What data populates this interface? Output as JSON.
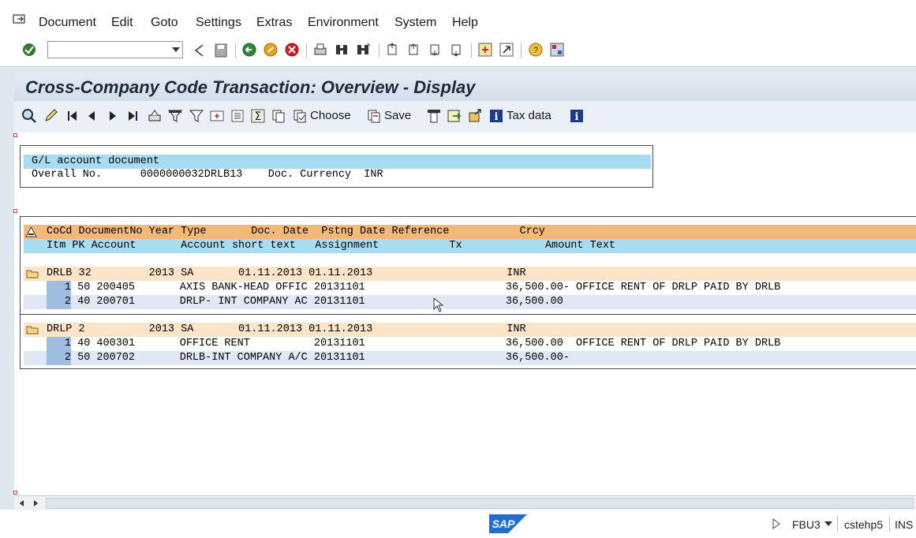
{
  "menu": {
    "items": [
      "Document",
      "Edit",
      "Goto",
      "Settings",
      "Extras",
      "Environment",
      "System",
      "Help"
    ]
  },
  "command_field": {
    "value": ""
  },
  "title": "Cross-Company Code Transaction: Overview - Display",
  "app_toolbar": {
    "choose_label": "Choose",
    "save_label": "Save",
    "tax_label": "Tax data"
  },
  "header": {
    "title": "G/L account document",
    "line": "Overall No.      0000000032DRLB13    Doc. Currency  INR"
  },
  "list": {
    "header1": "CoCd DocumentNo Year Type       Doc. Date  Pstng Date Reference           Crcy",
    "header2": "Itm PK Account       Account short text   Assignment           Tx             Amount Text",
    "groups": [
      {
        "line": "DRLB 32         2013 SA       01.11.2013 01.11.2013                     INR",
        "items": [
          {
            "itm": "1",
            "rest": " 50 200405       AXIS BANK-HEAD OFFIC 20131101                      36,500.00- OFFICE RENT OF DRLP PAID BY DRLB"
          },
          {
            "itm": "2",
            "rest": " 40 200701       DRLP- INT COMPANY AC 20131101                      36,500.00"
          }
        ]
      },
      {
        "line": "DRLP 2          2013 SA       01.11.2013 01.11.2013                     INR",
        "items": [
          {
            "itm": "1",
            "rest": " 40 400301       OFFICE RENT          20131101                      36,500.00  OFFICE RENT OF DRLP PAID BY DRLB"
          },
          {
            "itm": "2",
            "rest": " 50 200702       DRLB-INT COMPANY A/C 20131101                      36,500.00-"
          }
        ]
      }
    ]
  },
  "status": {
    "logo": "SAP",
    "tcode": "FBU3",
    "server": "cstehp5",
    "mode": "INS"
  }
}
